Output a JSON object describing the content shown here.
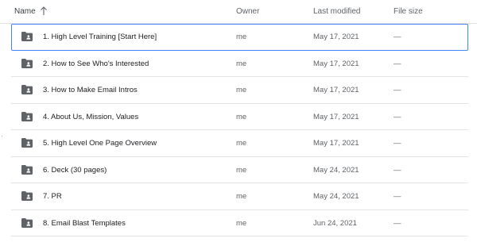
{
  "header": {
    "name": "Name",
    "owner": "Owner",
    "last_modified": "Last modified",
    "file_size": "File size",
    "sort_icon": "arrow-upward-icon"
  },
  "left_mark": "·",
  "rows": [
    {
      "name": "1. High Level Training [Start Here]",
      "owner": "me",
      "modified": "May 17, 2021",
      "size": "—",
      "icon": "shared-folder-icon",
      "selected": true
    },
    {
      "name": "2. How to See Who's Interested",
      "owner": "me",
      "modified": "May 17, 2021",
      "size": "—",
      "icon": "shared-folder-icon"
    },
    {
      "name": "3. How to Make Email Intros",
      "owner": "me",
      "modified": "May 17, 2021",
      "size": "—",
      "icon": "shared-folder-icon"
    },
    {
      "name": "4. About Us, Mission, Values",
      "owner": "me",
      "modified": "May 17, 2021",
      "size": "—",
      "icon": "shared-folder-icon"
    },
    {
      "name": "5. High Level One Page Overview",
      "owner": "me",
      "modified": "May 17, 2021",
      "size": "—",
      "icon": "shared-folder-icon"
    },
    {
      "name": "6. Deck (30 pages)",
      "owner": "me",
      "modified": "May 24, 2021",
      "size": "—",
      "icon": "shared-folder-icon"
    },
    {
      "name": "7. PR",
      "owner": "me",
      "modified": "May 24, 2021",
      "size": "—",
      "icon": "shared-folder-icon"
    },
    {
      "name": "8. Email Blast Templates",
      "owner": "me",
      "modified": "Jun 24, 2021",
      "size": "—",
      "icon": "shared-folder-icon"
    }
  ],
  "colors": {
    "selection_border": "#4285f4",
    "folder_icon": "#5f6368",
    "divider": "#e3e3e3"
  }
}
